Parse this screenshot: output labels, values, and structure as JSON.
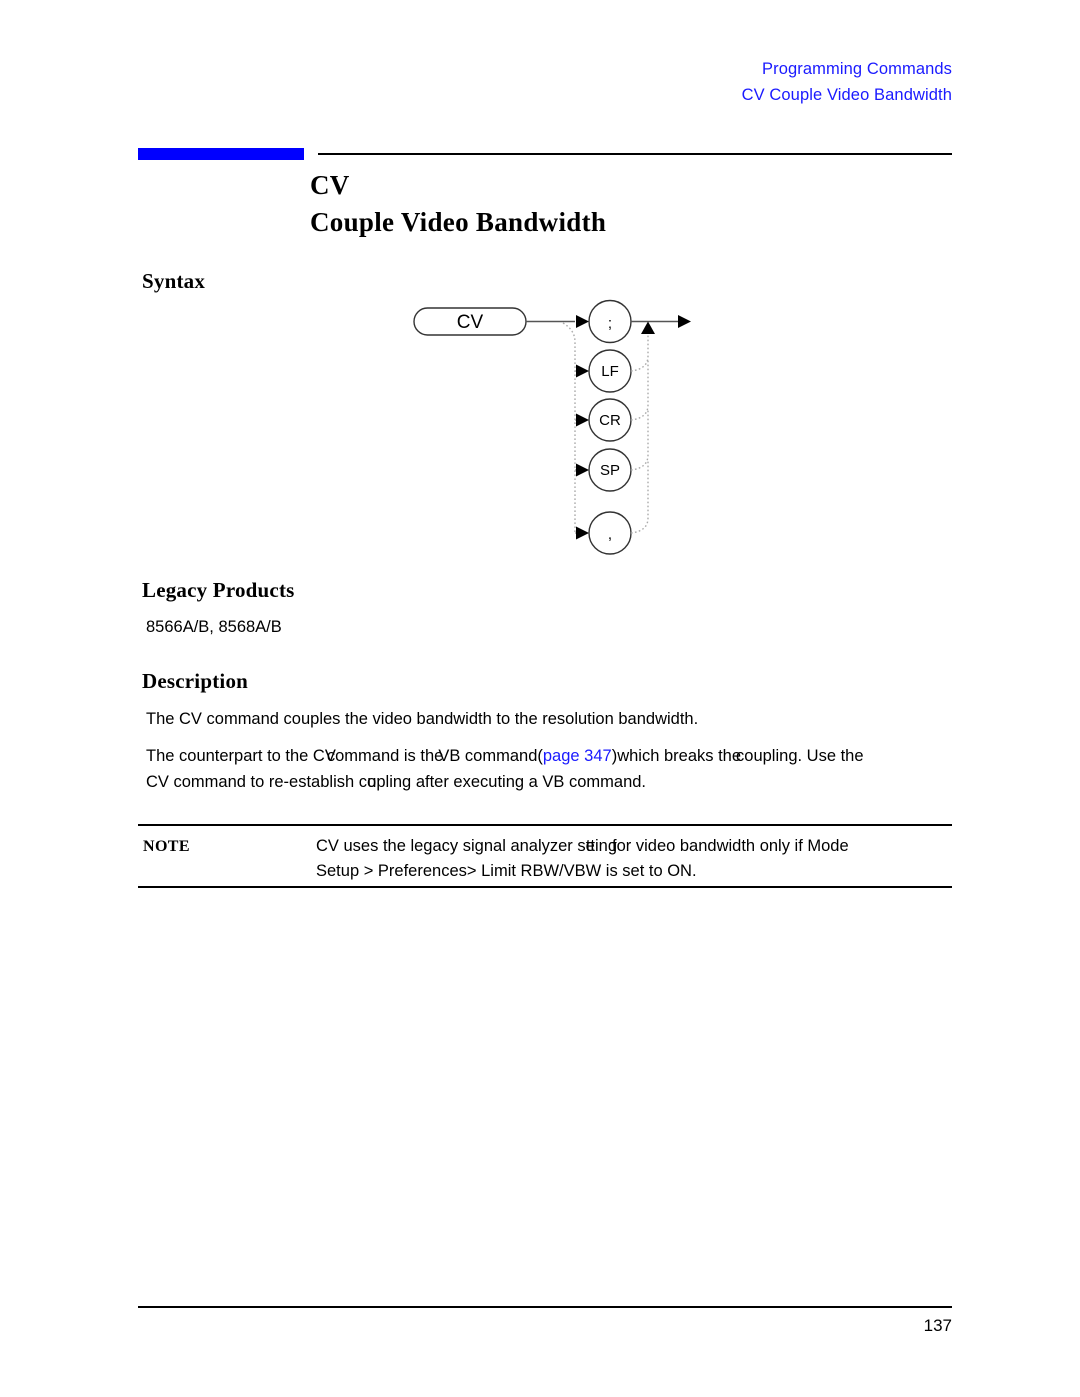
{
  "header": {
    "line1": "Programming Commands",
    "line2": "CV Couple Video Bandwidth"
  },
  "title": {
    "command": "CV",
    "name": "Couple Video Bandwidth"
  },
  "sections": {
    "syntax_heading": "Syntax",
    "legacy_heading": "Legacy Products",
    "legacy_products": "8566A/B, 8568A/B",
    "description_heading": "Description",
    "description_para1": "The CV command couples the video bandwidth to the resolution bandwidth."
  },
  "description_para2": {
    "line1_a": "The counterpart to the CV",
    "line1_b": "command is the",
    "line1_c": "VB command",
    "line1_d": "(",
    "line1_link": "page 347",
    "line1_e": ")",
    "line1_f": "which breaks the",
    "line1_g": "coupling. Use the",
    "line2_a": "CV command to re-establish co",
    "line2_b": "upling",
    "line2_c": " after executing a VB command."
  },
  "note": {
    "label": "NOTE",
    "line1_a": "CV uses the legacy signal analyzer se",
    "line1_b": "tting",
    "line1_c": "for video bandwidth only if Mode",
    "line2": "Setup > Preferences> Limit RBW/VBW is set to ON."
  },
  "syntax_diagram": {
    "command_node": "CV",
    "terminator_nodes": [
      ";",
      "LF",
      "CR",
      "SP",
      ","
    ]
  },
  "footer": {
    "page_number": "137"
  },
  "colors": {
    "header_blue": "#1a1aff",
    "accent_blue": "#0000ff",
    "link_blue": "#1a1aff",
    "text_black": "#000000"
  }
}
